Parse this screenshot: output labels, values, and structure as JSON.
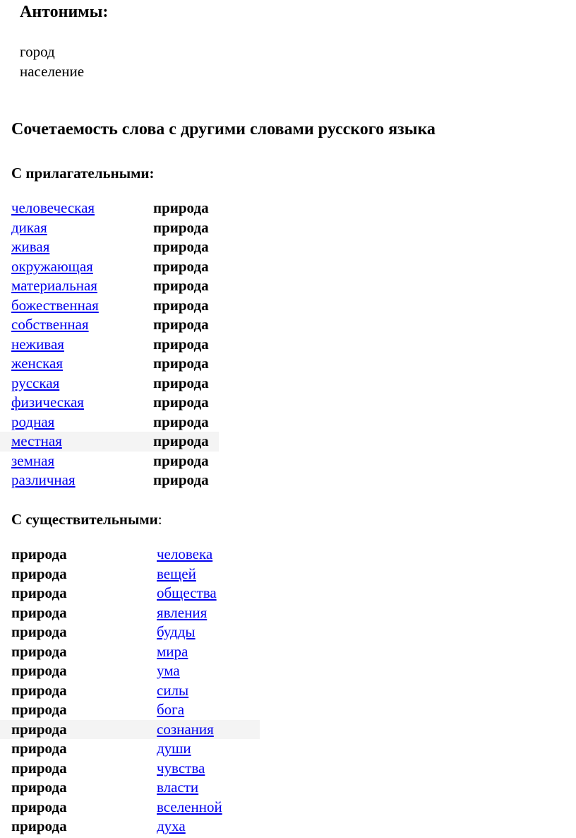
{
  "antonyms": {
    "heading": "Антонимы:",
    "items": [
      "город",
      "население"
    ]
  },
  "collocation": {
    "heading": "Сочетаемость слова с другими словами русского языка",
    "adjectives": {
      "heading": "С прилагательными:",
      "noun": "природа",
      "highlighted_index": 12,
      "items": [
        "человеческая",
        "дикая",
        "живая",
        "окружающая",
        "материальная",
        "божественная",
        "собственная",
        "неживая",
        "женская",
        "русская",
        "физическая",
        "родная",
        "местная",
        "земная",
        "различная"
      ]
    },
    "nouns": {
      "heading": "С существительными",
      "heading_suffix": ":",
      "noun": "природа",
      "highlighted_index": 9,
      "items": [
        "человека",
        "вещей",
        "общества",
        "явления",
        "будды",
        "мира",
        "ума",
        "силы",
        "бога",
        "сознания",
        "души",
        "чувства",
        "власти",
        "вселенной",
        "духа"
      ]
    }
  },
  "colors": {
    "link": "#0000ee",
    "highlight": "#f4f4f4"
  }
}
